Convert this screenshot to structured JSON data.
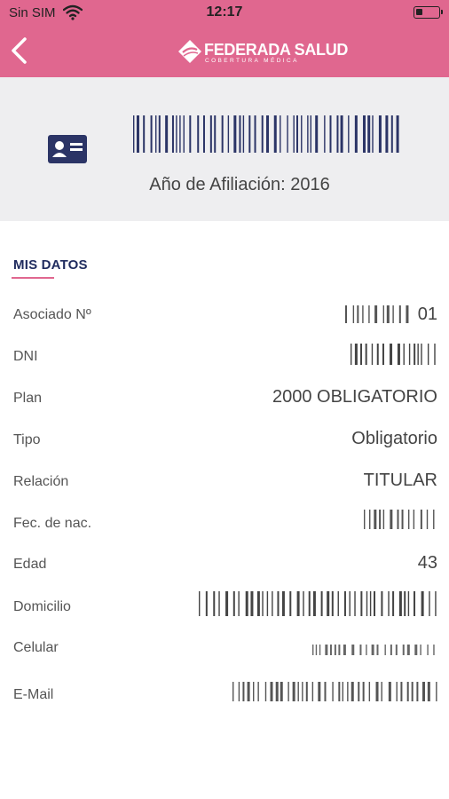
{
  "status_bar": {
    "carrier": "Sin SIM",
    "time": "12:17"
  },
  "header": {
    "brand_name": "FEDERADA SALUD",
    "brand_tagline": "COBERTURA MÉDICA",
    "color": "#e0678f"
  },
  "card": {
    "affiliation_text": "Año de Afiliación: 2016"
  },
  "section": {
    "title": "MIS DATOS"
  },
  "rows": [
    {
      "label": "Asociado Nº",
      "value": "01"
    },
    {
      "label": "DNI",
      "value": ""
    },
    {
      "label": "Plan",
      "value": "2000 OBLIGATORIO"
    },
    {
      "label": "Tipo",
      "value": "Obligatorio"
    },
    {
      "label": "Relación",
      "value": "TITULAR"
    },
    {
      "label": "Fec. de nac.",
      "value": ""
    },
    {
      "label": "Edad",
      "value": "43"
    },
    {
      "label": "Domicilio",
      "value": ""
    },
    {
      "label": "Celular",
      "value": ""
    },
    {
      "label": "E-Mail",
      "value": ""
    }
  ],
  "colors": {
    "accent": "#e0678f",
    "navy": "#1f2b5e",
    "band": "#eeeef0"
  }
}
